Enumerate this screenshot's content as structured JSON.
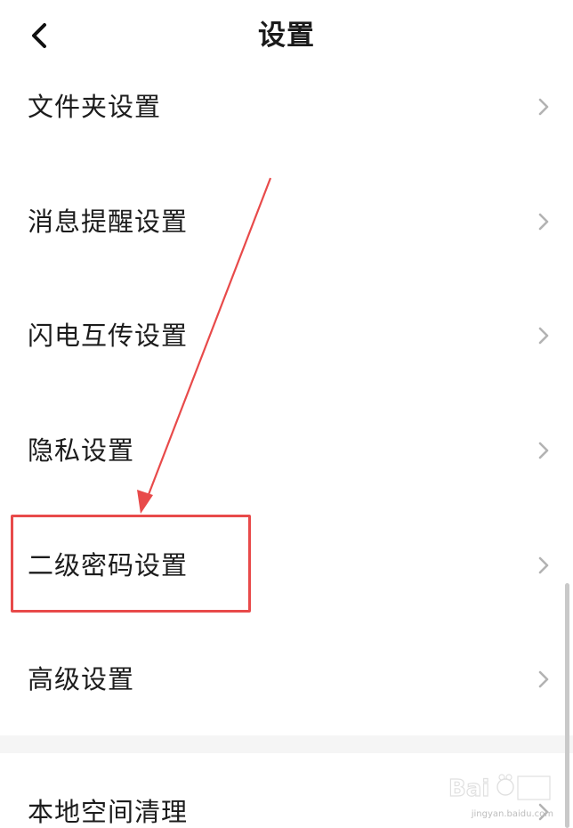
{
  "header": {
    "title": "设置",
    "back_icon": "chevron-left-icon"
  },
  "settings": {
    "items": [
      {
        "label": "文件夹设置"
      },
      {
        "label": "消息提醒设置"
      },
      {
        "label": "闪电互传设置"
      },
      {
        "label": "隐私设置"
      },
      {
        "label": "二级密码设置"
      },
      {
        "label": "高级设置"
      }
    ],
    "after_gap": [
      {
        "label": "本地空间清理"
      }
    ]
  },
  "annotation": {
    "highlight_color": "#e84a4a",
    "highlighted_item": "二级密码设置"
  },
  "watermark": {
    "text": "jingyan.baidu.com"
  }
}
